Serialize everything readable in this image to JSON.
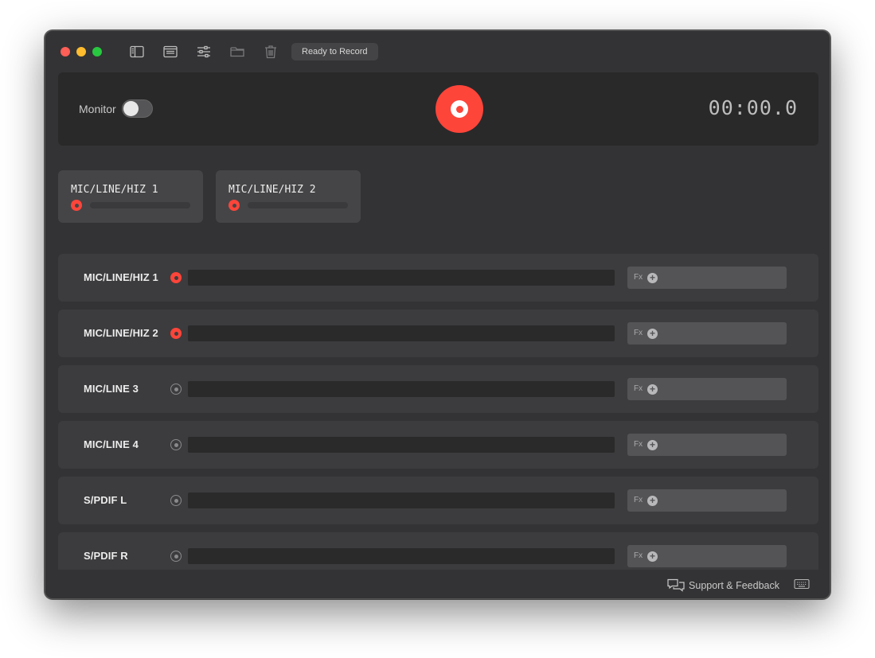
{
  "toolbar": {
    "icons": [
      "sidebar-icon",
      "window-icon",
      "sliders-icon",
      "folder-icon",
      "trash-icon"
    ],
    "status": "Ready to Record"
  },
  "transport": {
    "monitor_label": "Monitor",
    "monitor_on": false,
    "timer": "00:00.0",
    "accent": "#fe453a"
  },
  "tracks": [
    {
      "title": "MIC/LINE/HIZ 1"
    },
    {
      "title": "MIC/LINE/HIZ 2"
    }
  ],
  "channels": [
    {
      "name": "MIC/LINE/HIZ 1",
      "armed": true,
      "fx_label": "Fx"
    },
    {
      "name": "MIC/LINE/HIZ 2",
      "armed": true,
      "fx_label": "Fx"
    },
    {
      "name": "MIC/LINE 3",
      "armed": false,
      "fx_label": "Fx"
    },
    {
      "name": "MIC/LINE 4",
      "armed": false,
      "fx_label": "Fx"
    },
    {
      "name": "S/PDIF L",
      "armed": false,
      "fx_label": "Fx"
    },
    {
      "name": "S/PDIF R",
      "armed": false,
      "fx_label": "Fx"
    }
  ],
  "footer": {
    "support_label": "Support & Feedback"
  }
}
